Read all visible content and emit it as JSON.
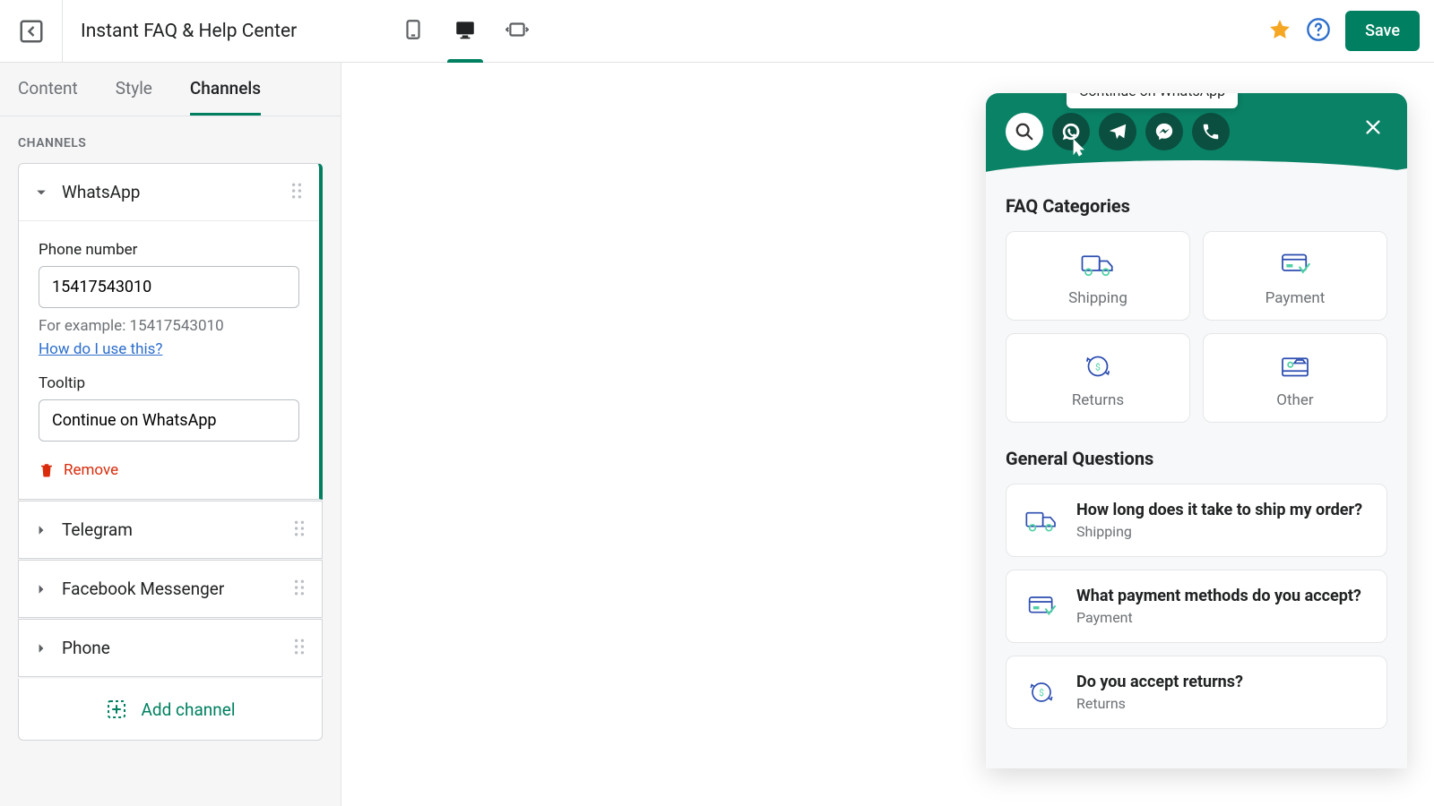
{
  "header": {
    "title": "Instant FAQ & Help Center",
    "save": "Save"
  },
  "tabs": {
    "content": "Content",
    "style": "Style",
    "channels": "Channels"
  },
  "sidebar": {
    "section_label": "CHANNELS",
    "whatsapp": {
      "name": "WhatsApp",
      "phone_label": "Phone number",
      "phone_value": "15417543010",
      "phone_help": "For example: 15417543010",
      "help_link": "How do I use this?",
      "tooltip_label": "Tooltip",
      "tooltip_value": "Continue on WhatsApp",
      "remove": "Remove"
    },
    "telegram": {
      "name": "Telegram"
    },
    "messenger": {
      "name": "Facebook Messenger"
    },
    "phone": {
      "name": "Phone"
    },
    "add_channel": "Add channel"
  },
  "widget": {
    "tooltip_text": "Continue on WhatsApp",
    "categories_title": "FAQ Categories",
    "categories": {
      "shipping": "Shipping",
      "payment": "Payment",
      "returns": "Returns",
      "other": "Other"
    },
    "general_title": "General Questions",
    "q1": {
      "title": "How long does it take to ship my order?",
      "cat": "Shipping"
    },
    "q2": {
      "title": "What payment methods do you accept?",
      "cat": "Payment"
    },
    "q3": {
      "title": "Do you accept returns?",
      "cat": "Returns"
    }
  }
}
